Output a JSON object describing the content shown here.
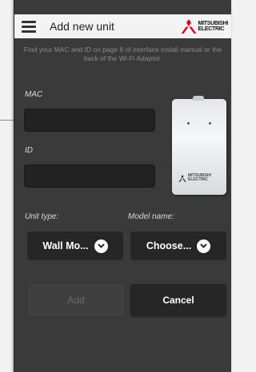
{
  "header": {
    "menu_icon": "hamburger-icon",
    "title": "Add new unit",
    "brand_line1": "MITSUBISHI",
    "brand_line2": "ELECTRIC"
  },
  "hint": "Find your MAC and ID on page 6 of interface install manual or the back of the Wi-Fi Adaptor.",
  "form": {
    "mac_label": "MAC",
    "mac_value": "",
    "id_label": "ID",
    "id_value": "",
    "unit_type_label": "Unit type:",
    "unit_type_value": "Wall Mo...",
    "model_name_label": "Model name:",
    "model_name_value": "Choose..."
  },
  "device": {
    "brand_line1": "MITSUBISHI",
    "brand_line2": "ELECTRIC"
  },
  "actions": {
    "add_label": "Add",
    "cancel_label": "Cancel"
  },
  "colors": {
    "background": "#3a3a3a",
    "header": "#f3f3f3",
    "brand_red": "#e4001b"
  }
}
